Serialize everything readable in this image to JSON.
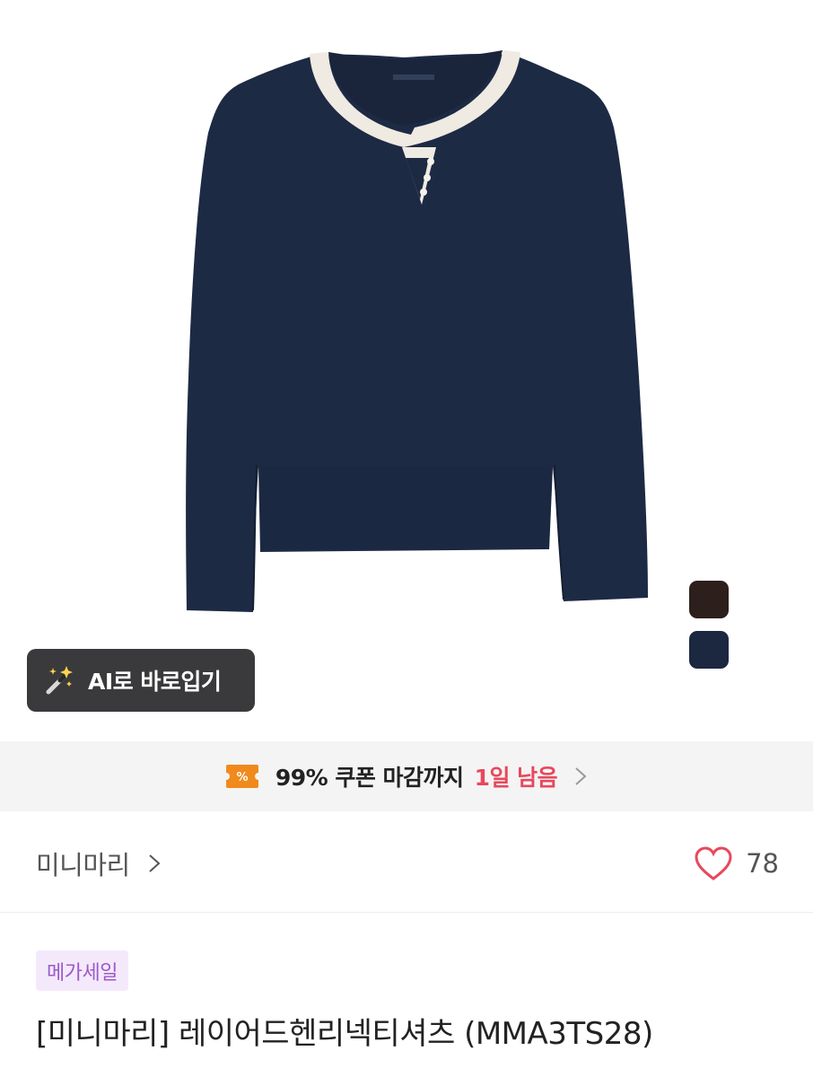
{
  "product": {
    "ai_try_on_label": "AI로 바로입기",
    "swatches": [
      {
        "name": "brown",
        "color": "#2c1f1c"
      },
      {
        "name": "navy",
        "color": "#1b2840"
      }
    ],
    "garment_color": "#1d2a44",
    "trim_color": "#efeae2"
  },
  "coupon": {
    "text": "99% 쿠폰 마감까지",
    "remaining": "1일 남음",
    "accent_color": "#f08a1c"
  },
  "brand": {
    "name": "미니마리",
    "like_count": "78",
    "like_color": "#e8485c"
  },
  "listing": {
    "badge": "메가세일",
    "title": "[미니마리] 레이어드헨리넥티셔츠 (MMA3TS28)"
  }
}
